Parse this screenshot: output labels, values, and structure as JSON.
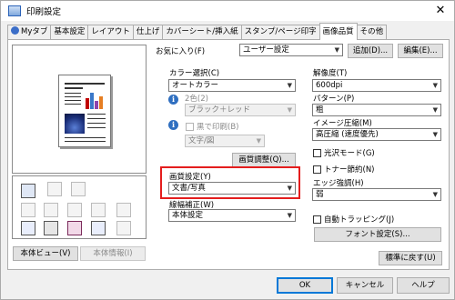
{
  "window": {
    "title": "印刷設定",
    "close": "✕"
  },
  "tabs": [
    "Myタブ",
    "基本設定",
    "レイアウト",
    "仕上げ",
    "カバーシート/挿入紙",
    "スタンプ/ページ印字",
    "画像品質",
    "その他"
  ],
  "favorites": {
    "label": "お気に入り(F)",
    "value": "ユーザー設定",
    "add": "追加(D)...",
    "edit": "編集(E)..."
  },
  "color": {
    "label": "カラー選択(C)",
    "value": "オートカラー",
    "two_color_label": "2色(2)",
    "two_color_value": "ブラック＋レッド",
    "black_print_label": "黒で印刷(B)",
    "black_print_value": "文字/図",
    "adjust_button": "画質調整(Q)..."
  },
  "quality": {
    "label": "画質設定(Y)",
    "value": "文書/写真",
    "brightness_label": "線幅補正(W)",
    "brightness_value": "本体設定"
  },
  "right": {
    "resolution_label": "解像度(T)",
    "resolution_value": "600dpi",
    "pattern_label": "パターン(P)",
    "pattern_value": "粗",
    "compression_label": "イメージ圧縮(M)",
    "compression_value": "高圧縮 (速度優先)",
    "glossy": "光沢モード(G)",
    "toner_save": "トナー節約(N)",
    "edge_label": "エッジ強調(H)",
    "edge_value": "弱",
    "auto_trapping": "自動トラッピング(J)",
    "font_button": "フォント設定(S)...",
    "reset_button": "標準に戻す(U)"
  },
  "left": {
    "view_button": "本体ビュー(V)",
    "info_button": "本体情報(I)"
  },
  "footer": {
    "ok": "OK",
    "cancel": "キャンセル",
    "help": "ヘルプ"
  }
}
